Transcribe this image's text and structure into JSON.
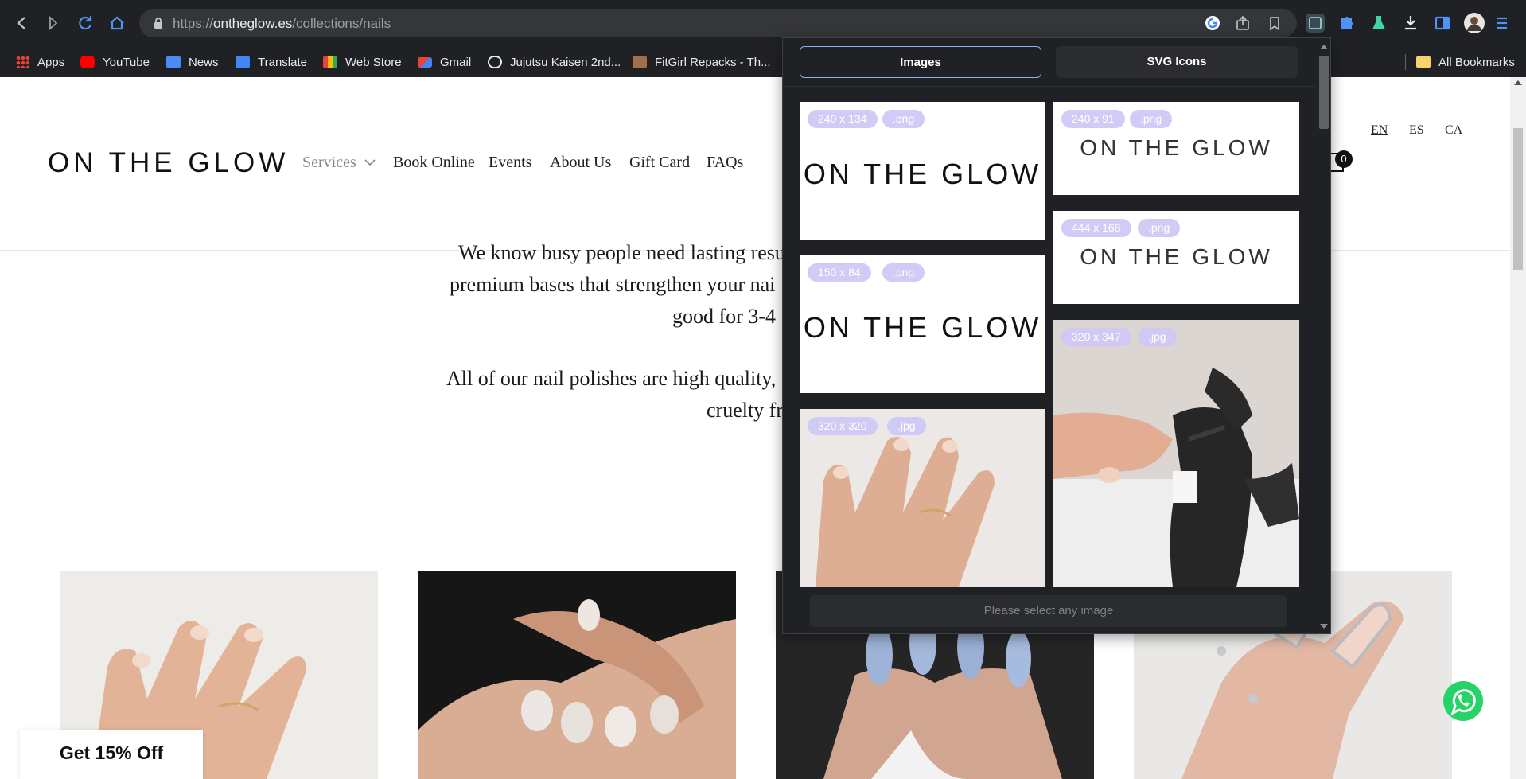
{
  "browser": {
    "url_domain": "ontheglow.es",
    "url_prefix": "https://",
    "url_path": "/collections/nails",
    "bookmarks": [
      "Apps",
      "YouTube",
      "News",
      "Translate",
      "Web Store",
      "Gmail",
      "Jujutsu Kaisen 2nd...",
      "FitGirl Repacks - Th...",
      "All Bookmarks"
    ]
  },
  "site": {
    "logo": "ON THE GLOW",
    "nav": [
      "Services",
      "Book Online",
      "Events",
      "About Us",
      "Gift Card",
      "FAQs"
    ],
    "languages": [
      "EN",
      "ES",
      "CA"
    ],
    "cart_count": "0",
    "body_lines": [
      "We know busy people need lasting resu",
      "premium bases that strengthen your nai",
      "good for 3-4",
      "All of our nail polishes are high quality, ",
      "cruelty fr"
    ],
    "discount_label": "Get 15% Off"
  },
  "extension": {
    "tabs": [
      "Images",
      "SVG Icons"
    ],
    "images": [
      {
        "size": "240 x 134",
        "ext": ".png",
        "content": "ON THE GLOW"
      },
      {
        "size": "240 x 91",
        "ext": ".png",
        "content": "ON THE GLOW"
      },
      {
        "size": "444 x 168",
        "ext": ".png",
        "content": "ON THE GLOW"
      },
      {
        "size": "150 x 84",
        "ext": ".png",
        "content": "ON THE GLOW"
      },
      {
        "size": "320 x 347",
        "ext": ".jpg"
      },
      {
        "size": "320 x 320",
        "ext": ".jpg"
      }
    ],
    "status": "Please select any image"
  }
}
